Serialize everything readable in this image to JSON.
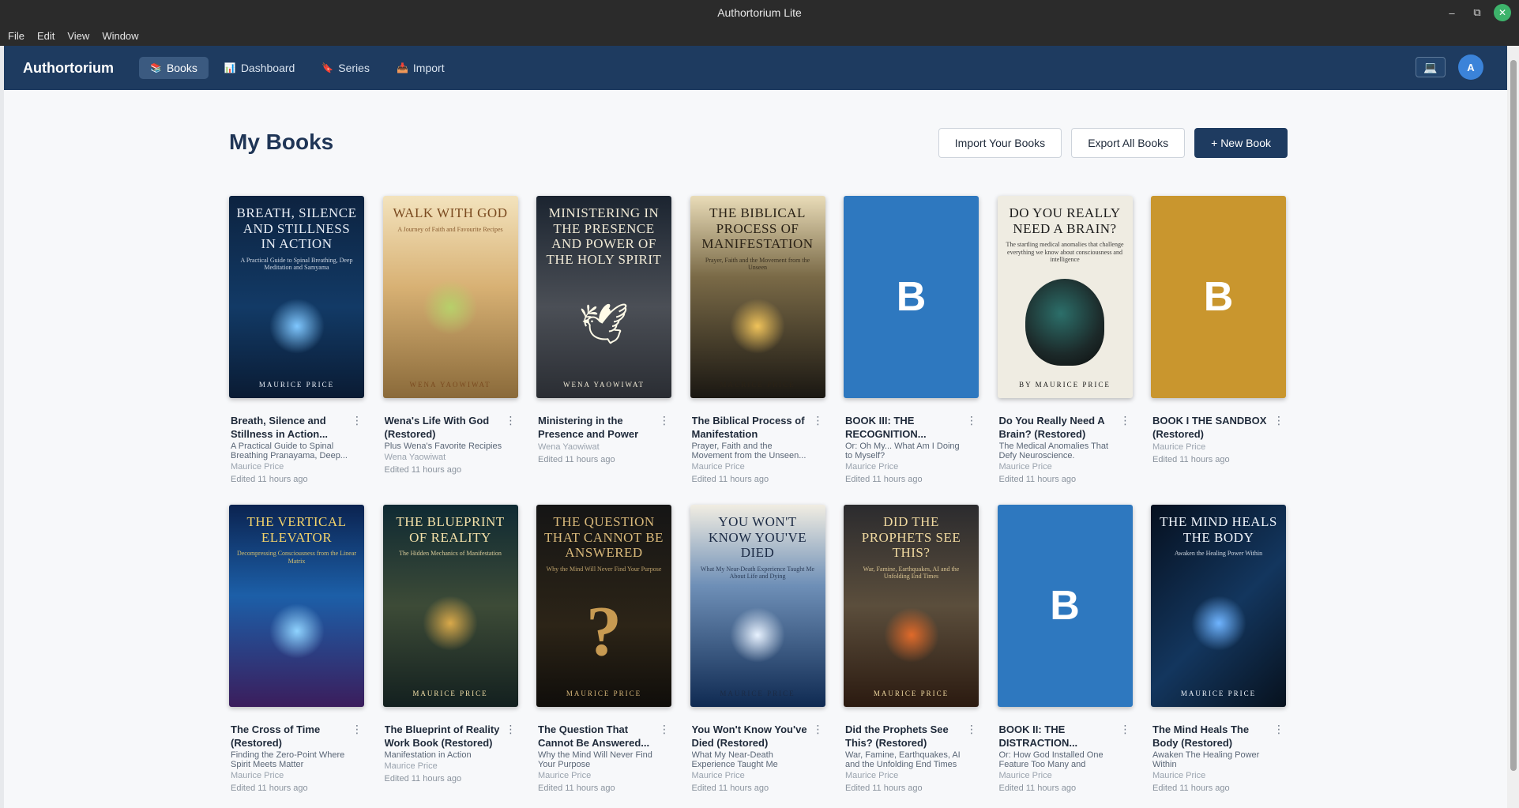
{
  "window": {
    "title": "Authortorium Lite"
  },
  "menu": [
    "File",
    "Edit",
    "View",
    "Window"
  ],
  "nav": {
    "brand": "Authortorium",
    "links": [
      {
        "label": "Books",
        "icon": "books-icon",
        "active": true
      },
      {
        "label": "Dashboard",
        "icon": "chart-icon",
        "active": false
      },
      {
        "label": "Series",
        "icon": "bookmark-icon",
        "active": false
      },
      {
        "label": "Import",
        "icon": "inbox-icon",
        "active": false
      }
    ],
    "avatar_initial": "A"
  },
  "page": {
    "title": "My Books",
    "import_label": "Import Your Books",
    "export_label": "Export All Books",
    "new_label": "+ New Book"
  },
  "books": [
    {
      "title": "Breath, Silence and Stillness in Action...",
      "subtitle": "A Practical Guide to Spinal Breathing Pranayama, Deep...",
      "author": "Maurice Price",
      "edited": "Edited 11 hours ago",
      "cover": {
        "kind": "art",
        "bg": "linear-gradient(180deg,#0d2340 0%,#123a66 55%,#0a1b33 100%)",
        "color": "#e9eef6",
        "title": "Breath, Silence and Stillness in Action",
        "sub": "A Practical Guide to Spinal Breathing, Deep Meditation and Samyama",
        "author": "Maurice Price",
        "accent": "#7fc7ff"
      }
    },
    {
      "title": "Wena's Life With God (Restored)",
      "subtitle": "Plus Wena's Favorite Recipies",
      "author": "Wena Yaowiwat",
      "edited": "Edited 11 hours ago",
      "cover": {
        "kind": "art",
        "bg": "linear-gradient(180deg,#f3e3bd 0%,#d8b174 45%,#8a6a3a 100%)",
        "color": "#7a4a1f",
        "title": "Walk With God",
        "sub": "A Journey of Faith and Favourite Recipes",
        "author": "Wena Yaowiwat",
        "accent": "#b7d06a"
      }
    },
    {
      "title": "Ministering in the Presence and Power o...",
      "subtitle": "",
      "author": "Wena Yaowiwat",
      "edited": "Edited 11 hours ago",
      "cover": {
        "kind": "dove",
        "bg": "linear-gradient(180deg,#1b2430 0%,#4b4f56 55%,#2a2d33 100%)",
        "color": "#f1ead6",
        "title": "Ministering in the Presence and Power of the Holy Spirit",
        "sub": "",
        "author": "Wena Yaowiwat",
        "accent": "#fff"
      }
    },
    {
      "title": "The Biblical Process of Manifestation (Restored)",
      "subtitle": "Prayer, Faith and the Movement from the Unseen...",
      "author": "Maurice Price",
      "edited": "Edited 11 hours ago",
      "cover": {
        "kind": "art",
        "bg": "linear-gradient(180deg,#e9dcb8 0%,#7a6a47 40%,#1a1712 100%)",
        "color": "#2a2216",
        "title": "The Biblical Process of Manifestation",
        "sub": "Prayer, Faith and the Movement from the Unseen",
        "author": "Maurice Price",
        "accent": "#f0c35a"
      }
    },
    {
      "title": "BOOK III: THE RECOGNITION...",
      "subtitle": "Or: Oh My... What Am I Doing to Myself?",
      "author": "Maurice Price",
      "edited": "Edited 11 hours ago",
      "cover": {
        "kind": "placeholder",
        "bg": "#2e78bf",
        "letter": "B"
      }
    },
    {
      "title": "Do You Really Need A Brain? (Restored)",
      "subtitle": "The Medical Anomalies That Defy Neuroscience.",
      "author": "Maurice Price",
      "edited": "Edited 11 hours ago",
      "cover": {
        "kind": "brain",
        "bg": "#efece2",
        "color": "#1a1a1a",
        "title": "Do You Really Need A Brain?",
        "sub": "The startling medical anomalies that challenge everything we know about consciousness and intelligence",
        "author": "by Maurice Price",
        "accent": "#2c6f6a"
      }
    },
    {
      "title": "BOOK I THE SANDBOX (Restored)",
      "subtitle": "",
      "author": "Maurice Price",
      "edited": "Edited 11 hours ago",
      "cover": {
        "kind": "placeholder",
        "bg": "#c9962e",
        "letter": "B"
      }
    },
    {
      "title": "The Cross of Time (Restored)",
      "subtitle": "Finding the Zero-Point Where Spirit Meets Matter",
      "author": "Maurice Price",
      "edited": "Edited 11 hours ago",
      "cover": {
        "kind": "art",
        "bg": "linear-gradient(180deg,#0b2350 0%,#1c5fa8 45%,#3b1d5c 100%)",
        "color": "#f3d36b",
        "title": "The Vertical Elevator",
        "sub": "Decompressing Consciousness from the Linear Matrix",
        "author": "",
        "accent": "#8fd3ff"
      }
    },
    {
      "title": "The Blueprint of Reality Work Book (Restored)",
      "subtitle": "Manifestation in Action",
      "author": "Maurice Price",
      "edited": "Edited 11 hours ago",
      "cover": {
        "kind": "art",
        "bg": "linear-gradient(180deg,#0f2a33 0%,#3d4b37 50%,#13201f 100%)",
        "color": "#f3e0a8",
        "title": "The Blueprint of Reality",
        "sub": "The Hidden Mechanics of Manifestation",
        "author": "Maurice Price",
        "accent": "#d9a94a"
      }
    },
    {
      "title": "The Question That Cannot Be Answered...",
      "subtitle": "Why the Mind Will Never Find Your Purpose",
      "author": "Maurice Price",
      "edited": "Edited 11 hours ago",
      "cover": {
        "kind": "question",
        "bg": "linear-gradient(180deg,#151515 0%,#2c2417 60%,#0f0d0a 100%)",
        "color": "#d8b87a",
        "title": "The Question That Cannot Be Answered",
        "sub": "Why the Mind Will Never Find Your Purpose",
        "author": "Maurice Price",
        "accent": "#c79a52"
      }
    },
    {
      "title": "You Won't Know You've Died (Restored)",
      "subtitle": "What My Near-Death Experience Taught Me About...",
      "author": "Maurice Price",
      "edited": "Edited 11 hours ago",
      "cover": {
        "kind": "art",
        "bg": "linear-gradient(180deg,#f1ede2 0%,#6e8fb7 40%,#0f2a52 100%)",
        "color": "#1b2a44",
        "title": "You Won't Know You've Died",
        "sub": "What My Near-Death Experience Taught Me About Life and Dying",
        "author": "Maurice Price",
        "accent": "#e8f2ff"
      }
    },
    {
      "title": "Did the Prophets See This? (Restored)",
      "subtitle": "War, Famine, Earthquakes, AI and the Unfolding End Times",
      "author": "Maurice Price",
      "edited": "Edited 11 hours ago",
      "cover": {
        "kind": "art",
        "bg": "linear-gradient(180deg,#2b2b2e 0%,#5b4e3c 50%,#2b1a10 100%)",
        "color": "#f0d9a0",
        "title": "Did the Prophets See This?",
        "sub": "War, Famine, Earthquakes, AI and the Unfolding End Times",
        "author": "Maurice Price",
        "accent": "#e06a2a"
      }
    },
    {
      "title": "BOOK II: THE DISTRACTION...",
      "subtitle": "Or: How God Installed One Feature Too Many and Forgo...",
      "author": "Maurice Price",
      "edited": "Edited 11 hours ago",
      "cover": {
        "kind": "placeholder",
        "bg": "#2e78bf",
        "letter": "B"
      }
    },
    {
      "title": "The Mind Heals The Body (Restored)",
      "subtitle": "Awaken The Healing Power Within",
      "author": "Maurice Price",
      "edited": "Edited 11 hours ago",
      "cover": {
        "kind": "art",
        "bg": "linear-gradient(135deg,#06101f 0%,#13365e 55%,#07111d 100%)",
        "color": "#eef3fa",
        "title": "The Mind Heals The Body",
        "sub": "Awaken the Healing Power Within",
        "author": "Maurice Price",
        "accent": "#6fb4ff"
      }
    }
  ]
}
